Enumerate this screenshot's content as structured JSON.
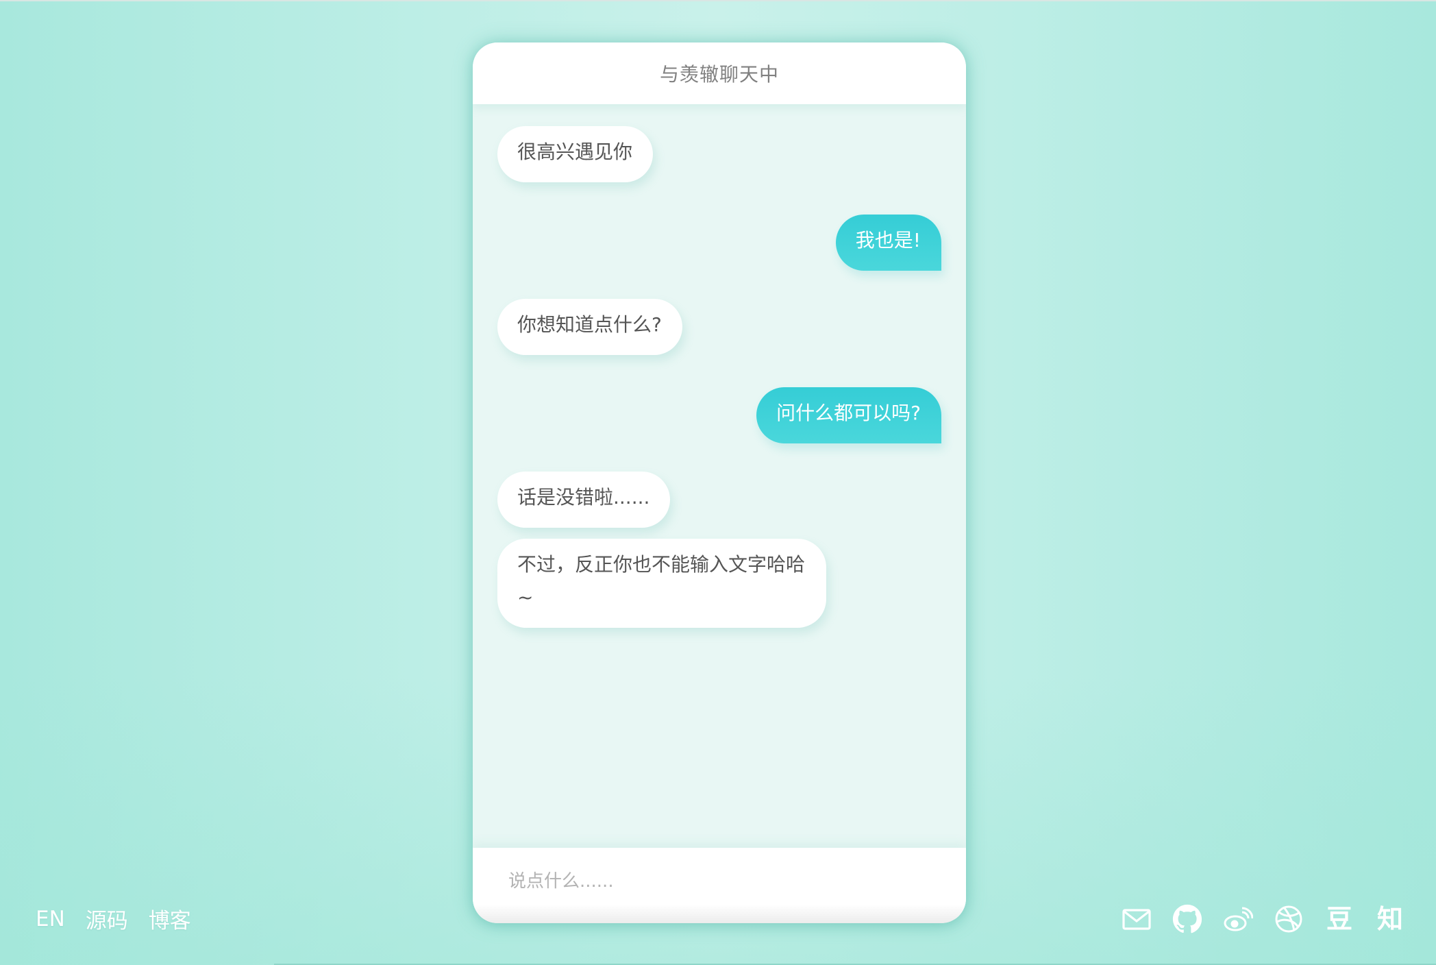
{
  "chat": {
    "title": "与羡辙聊天中",
    "messages": [
      {
        "from": "bot",
        "text": "很高兴遇见你"
      },
      {
        "from": "user",
        "text": "我也是!"
      },
      {
        "from": "bot",
        "text": "你想知道点什么?"
      },
      {
        "from": "user",
        "text": "问什么都可以吗?"
      },
      {
        "from": "bot",
        "text": "话是没错啦......"
      },
      {
        "from": "bot",
        "text": "不过，反正你也不能输入文字哈哈~"
      }
    ],
    "input_placeholder": "说点什么......"
  },
  "footer": {
    "links": [
      "EN",
      "源码",
      "博客"
    ],
    "social": {
      "douban": "豆",
      "zhihu": "知"
    },
    "icons": [
      "mail-icon",
      "github-icon",
      "weibo-icon",
      "dribbble-icon"
    ]
  },
  "colors": {
    "accent": "#3ecfd8",
    "background": "#b9ece3",
    "bot_bubble": "#ffffff",
    "bot_text": "#555555"
  }
}
